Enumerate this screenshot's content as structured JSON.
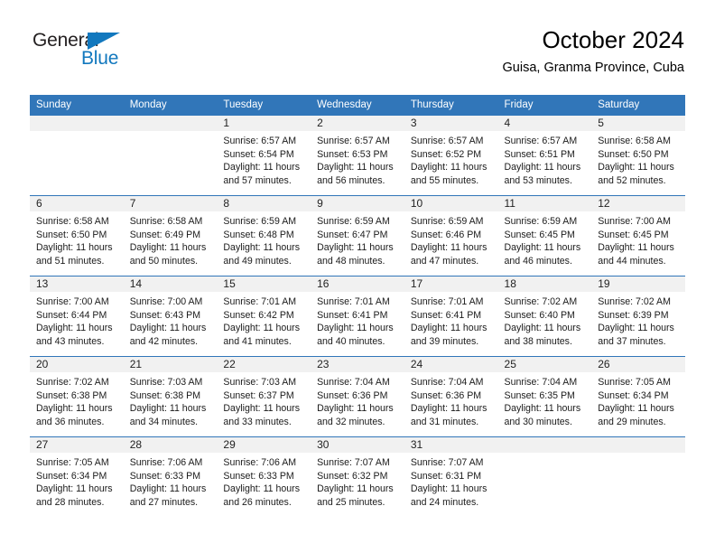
{
  "brand": {
    "name_part1": "General",
    "name_part2": "Blue",
    "accent_color": "#1278be",
    "triangle_icon": "triangle-icon"
  },
  "header": {
    "title": "October 2024",
    "subtitle": "Guisa, Granma Province, Cuba"
  },
  "calendar": {
    "header_bg": "#3176b9",
    "daynum_band_bg": "#f1f1f1",
    "weekday_headers": [
      "Sunday",
      "Monday",
      "Tuesday",
      "Wednesday",
      "Thursday",
      "Friday",
      "Saturday"
    ],
    "labels": {
      "sunrise_prefix": "Sunrise:",
      "sunset_prefix": "Sunset:",
      "daylight_prefix": "Daylight:"
    },
    "weeks": [
      [
        {
          "day": "",
          "sunrise": "",
          "sunset": "",
          "daylight": ""
        },
        {
          "day": "",
          "sunrise": "",
          "sunset": "",
          "daylight": ""
        },
        {
          "day": "1",
          "sunrise": "Sunrise: 6:57 AM",
          "sunset": "Sunset: 6:54 PM",
          "daylight": "Daylight: 11 hours and 57 minutes."
        },
        {
          "day": "2",
          "sunrise": "Sunrise: 6:57 AM",
          "sunset": "Sunset: 6:53 PM",
          "daylight": "Daylight: 11 hours and 56 minutes."
        },
        {
          "day": "3",
          "sunrise": "Sunrise: 6:57 AM",
          "sunset": "Sunset: 6:52 PM",
          "daylight": "Daylight: 11 hours and 55 minutes."
        },
        {
          "day": "4",
          "sunrise": "Sunrise: 6:57 AM",
          "sunset": "Sunset: 6:51 PM",
          "daylight": "Daylight: 11 hours and 53 minutes."
        },
        {
          "day": "5",
          "sunrise": "Sunrise: 6:58 AM",
          "sunset": "Sunset: 6:50 PM",
          "daylight": "Daylight: 11 hours and 52 minutes."
        }
      ],
      [
        {
          "day": "6",
          "sunrise": "Sunrise: 6:58 AM",
          "sunset": "Sunset: 6:50 PM",
          "daylight": "Daylight: 11 hours and 51 minutes."
        },
        {
          "day": "7",
          "sunrise": "Sunrise: 6:58 AM",
          "sunset": "Sunset: 6:49 PM",
          "daylight": "Daylight: 11 hours and 50 minutes."
        },
        {
          "day": "8",
          "sunrise": "Sunrise: 6:59 AM",
          "sunset": "Sunset: 6:48 PM",
          "daylight": "Daylight: 11 hours and 49 minutes."
        },
        {
          "day": "9",
          "sunrise": "Sunrise: 6:59 AM",
          "sunset": "Sunset: 6:47 PM",
          "daylight": "Daylight: 11 hours and 48 minutes."
        },
        {
          "day": "10",
          "sunrise": "Sunrise: 6:59 AM",
          "sunset": "Sunset: 6:46 PM",
          "daylight": "Daylight: 11 hours and 47 minutes."
        },
        {
          "day": "11",
          "sunrise": "Sunrise: 6:59 AM",
          "sunset": "Sunset: 6:45 PM",
          "daylight": "Daylight: 11 hours and 46 minutes."
        },
        {
          "day": "12",
          "sunrise": "Sunrise: 7:00 AM",
          "sunset": "Sunset: 6:45 PM",
          "daylight": "Daylight: 11 hours and 44 minutes."
        }
      ],
      [
        {
          "day": "13",
          "sunrise": "Sunrise: 7:00 AM",
          "sunset": "Sunset: 6:44 PM",
          "daylight": "Daylight: 11 hours and 43 minutes."
        },
        {
          "day": "14",
          "sunrise": "Sunrise: 7:00 AM",
          "sunset": "Sunset: 6:43 PM",
          "daylight": "Daylight: 11 hours and 42 minutes."
        },
        {
          "day": "15",
          "sunrise": "Sunrise: 7:01 AM",
          "sunset": "Sunset: 6:42 PM",
          "daylight": "Daylight: 11 hours and 41 minutes."
        },
        {
          "day": "16",
          "sunrise": "Sunrise: 7:01 AM",
          "sunset": "Sunset: 6:41 PM",
          "daylight": "Daylight: 11 hours and 40 minutes."
        },
        {
          "day": "17",
          "sunrise": "Sunrise: 7:01 AM",
          "sunset": "Sunset: 6:41 PM",
          "daylight": "Daylight: 11 hours and 39 minutes."
        },
        {
          "day": "18",
          "sunrise": "Sunrise: 7:02 AM",
          "sunset": "Sunset: 6:40 PM",
          "daylight": "Daylight: 11 hours and 38 minutes."
        },
        {
          "day": "19",
          "sunrise": "Sunrise: 7:02 AM",
          "sunset": "Sunset: 6:39 PM",
          "daylight": "Daylight: 11 hours and 37 minutes."
        }
      ],
      [
        {
          "day": "20",
          "sunrise": "Sunrise: 7:02 AM",
          "sunset": "Sunset: 6:38 PM",
          "daylight": "Daylight: 11 hours and 36 minutes."
        },
        {
          "day": "21",
          "sunrise": "Sunrise: 7:03 AM",
          "sunset": "Sunset: 6:38 PM",
          "daylight": "Daylight: 11 hours and 34 minutes."
        },
        {
          "day": "22",
          "sunrise": "Sunrise: 7:03 AM",
          "sunset": "Sunset: 6:37 PM",
          "daylight": "Daylight: 11 hours and 33 minutes."
        },
        {
          "day": "23",
          "sunrise": "Sunrise: 7:04 AM",
          "sunset": "Sunset: 6:36 PM",
          "daylight": "Daylight: 11 hours and 32 minutes."
        },
        {
          "day": "24",
          "sunrise": "Sunrise: 7:04 AM",
          "sunset": "Sunset: 6:36 PM",
          "daylight": "Daylight: 11 hours and 31 minutes."
        },
        {
          "day": "25",
          "sunrise": "Sunrise: 7:04 AM",
          "sunset": "Sunset: 6:35 PM",
          "daylight": "Daylight: 11 hours and 30 minutes."
        },
        {
          "day": "26",
          "sunrise": "Sunrise: 7:05 AM",
          "sunset": "Sunset: 6:34 PM",
          "daylight": "Daylight: 11 hours and 29 minutes."
        }
      ],
      [
        {
          "day": "27",
          "sunrise": "Sunrise: 7:05 AM",
          "sunset": "Sunset: 6:34 PM",
          "daylight": "Daylight: 11 hours and 28 minutes."
        },
        {
          "day": "28",
          "sunrise": "Sunrise: 7:06 AM",
          "sunset": "Sunset: 6:33 PM",
          "daylight": "Daylight: 11 hours and 27 minutes."
        },
        {
          "day": "29",
          "sunrise": "Sunrise: 7:06 AM",
          "sunset": "Sunset: 6:33 PM",
          "daylight": "Daylight: 11 hours and 26 minutes."
        },
        {
          "day": "30",
          "sunrise": "Sunrise: 7:07 AM",
          "sunset": "Sunset: 6:32 PM",
          "daylight": "Daylight: 11 hours and 25 minutes."
        },
        {
          "day": "31",
          "sunrise": "Sunrise: 7:07 AM",
          "sunset": "Sunset: 6:31 PM",
          "daylight": "Daylight: 11 hours and 24 minutes."
        },
        {
          "day": "",
          "sunrise": "",
          "sunset": "",
          "daylight": ""
        },
        {
          "day": "",
          "sunrise": "",
          "sunset": "",
          "daylight": ""
        }
      ]
    ]
  }
}
